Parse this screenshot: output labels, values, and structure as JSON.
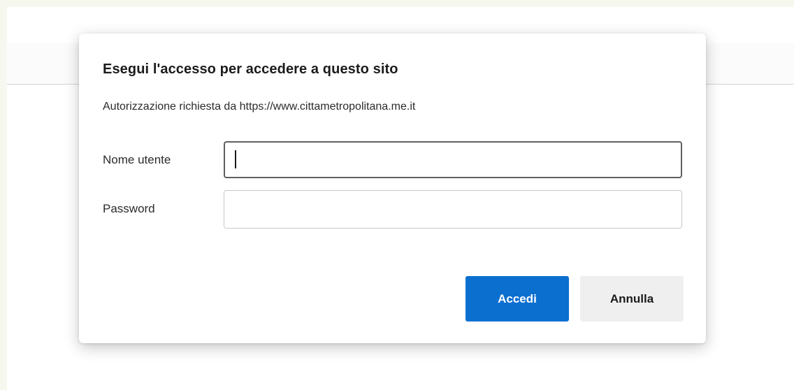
{
  "dialog": {
    "title": "Esegui l'accesso per accedere a questo sito",
    "subtitle": "Autorizzazione richiesta da https://www.cittametropolitana.me.it",
    "username_label": "Nome utente",
    "username_value": "",
    "password_label": "Password",
    "password_value": "",
    "submit_label": "Accedi",
    "cancel_label": "Annulla"
  },
  "colors": {
    "primary_button": "#0b6fd0",
    "secondary_button": "#efefef",
    "background": "#f6f8f0"
  }
}
